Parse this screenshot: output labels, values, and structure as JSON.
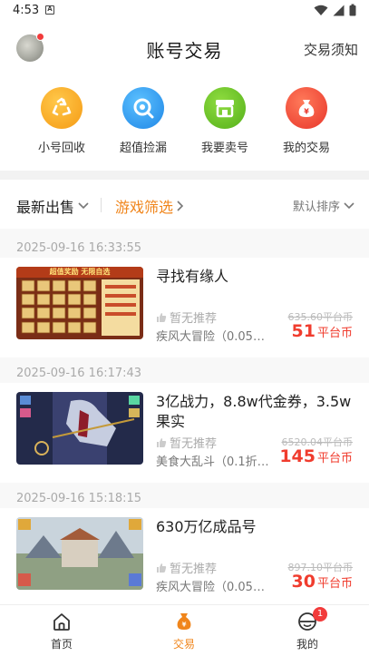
{
  "status_bar": {
    "time": "4:53",
    "badge_letter": "A"
  },
  "header": {
    "title": "账号交易",
    "link_label": "交易须知"
  },
  "actions": [
    {
      "label": "小号回收",
      "icon": "recycle-icon",
      "color": "#f7a823"
    },
    {
      "label": "超值捡漏",
      "icon": "search-icon",
      "color": "#2f97ee"
    },
    {
      "label": "我要卖号",
      "icon": "shop-icon",
      "color": "#6cc22b"
    },
    {
      "label": "我的交易",
      "icon": "money-bag-icon",
      "color": "#f2482f"
    }
  ],
  "filters": {
    "sort_label": "最新出售",
    "game_filter_label": "游戏筛选",
    "default_sort_label": "默认排序"
  },
  "listings": [
    {
      "date": "2025-09-16 16:33:55",
      "title": "寻找有缘人",
      "rec_label": "暂无推荐",
      "game": "疾风大冒险（0.05折…",
      "orig_price": "635.60平台币",
      "price": "51",
      "price_unit": "平台币",
      "thumb_text": "超值奖励 无限自选"
    },
    {
      "date": "2025-09-16 16:17:43",
      "title": "3亿战力，8.8w代金券，3.5w果实",
      "rec_label": "暂无推荐",
      "game": "美食大乱斗（0.1折…",
      "orig_price": "6520.04平台币",
      "price": "145",
      "price_unit": "平台币",
      "thumb_text": ""
    },
    {
      "date": "2025-09-16 15:18:15",
      "title": "630万亿成品号",
      "rec_label": "暂无推荐",
      "game": "疾风大冒险（0.05折…",
      "orig_price": "897.10平台币",
      "price": "30",
      "price_unit": "平台币",
      "thumb_text": ""
    }
  ],
  "bottom_nav": [
    {
      "label": "首页",
      "icon": "home-icon",
      "active": false
    },
    {
      "label": "交易",
      "icon": "money-bag-icon",
      "active": true
    },
    {
      "label": "我的",
      "icon": "profile-icon",
      "active": false,
      "badge": "1"
    }
  ],
  "colors": {
    "accent": "#f0851b",
    "price": "#f03c2e",
    "badge": "#f23b3b"
  }
}
